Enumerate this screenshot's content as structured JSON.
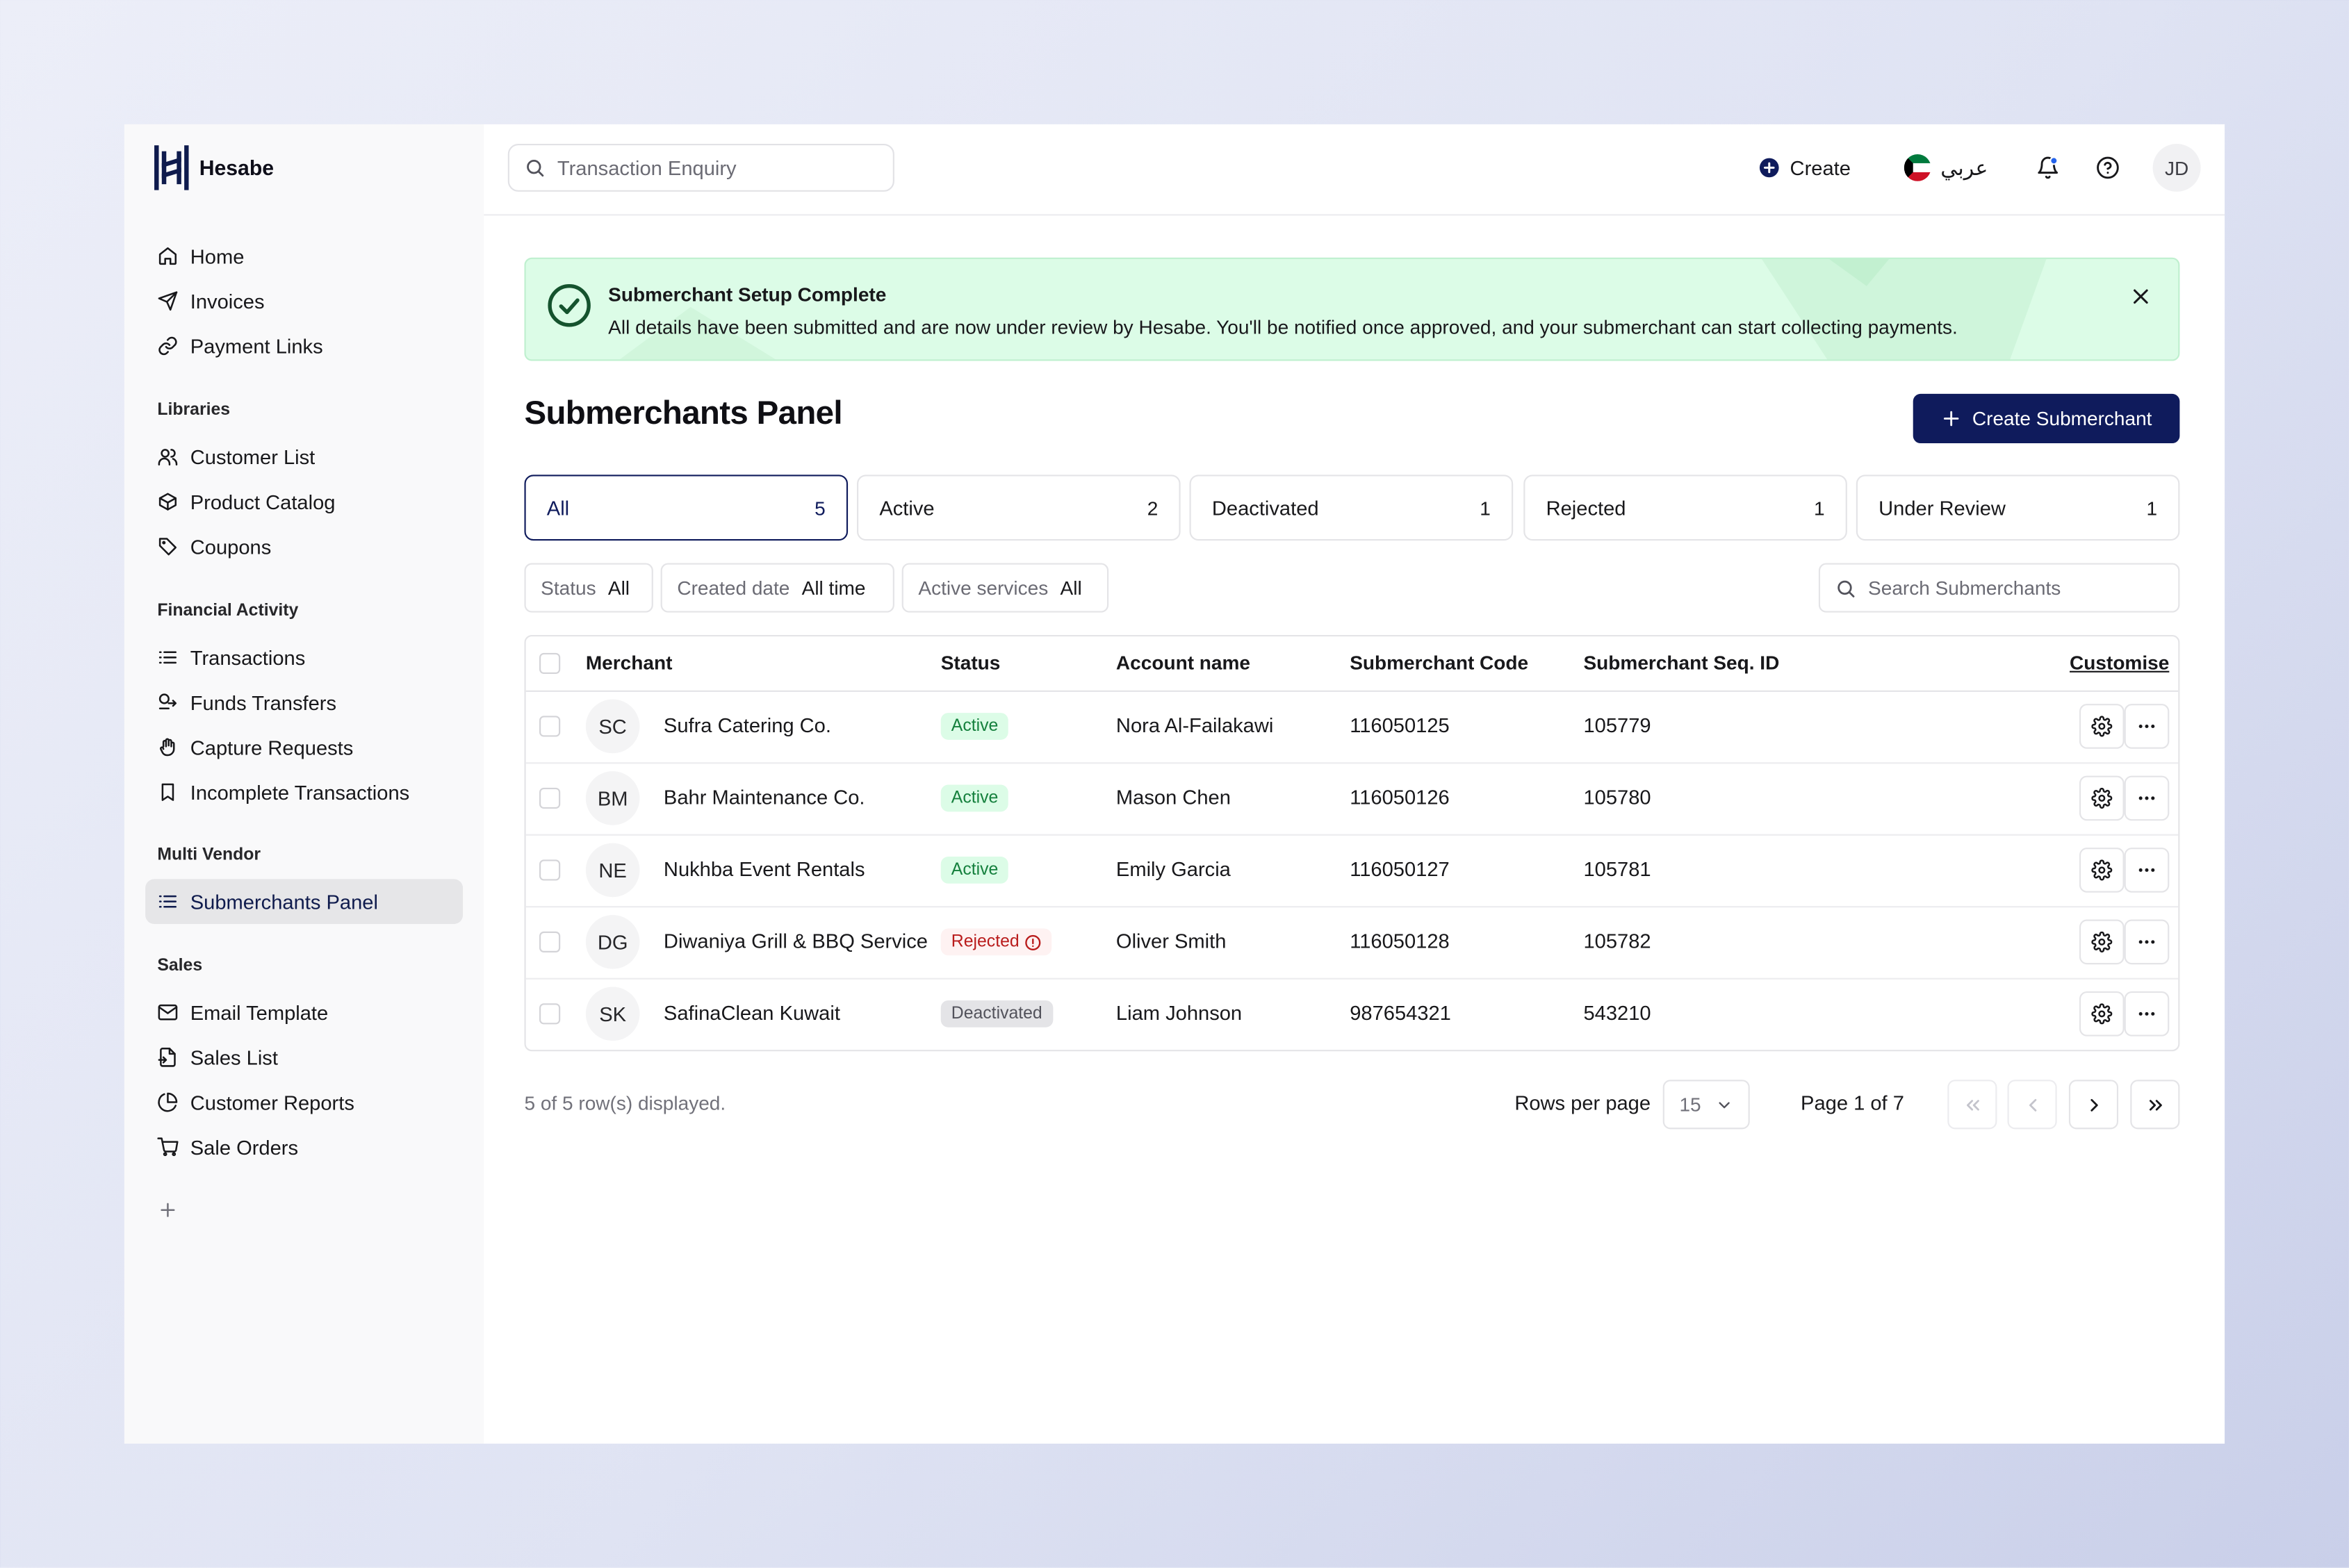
{
  "app": {
    "name": "Hesabe"
  },
  "sidebar": {
    "top_items": [
      {
        "label": "Home",
        "icon": "home-icon"
      },
      {
        "label": "Invoices",
        "icon": "send-icon"
      },
      {
        "label": "Payment Links",
        "icon": "link-icon"
      }
    ],
    "sections": [
      {
        "title": "Libraries",
        "items": [
          {
            "label": "Customer List",
            "icon": "users-icon"
          },
          {
            "label": "Product Catalog",
            "icon": "package-icon"
          },
          {
            "label": "Coupons",
            "icon": "tag-icon"
          }
        ]
      },
      {
        "title": "Financial Activity",
        "items": [
          {
            "label": "Transactions",
            "icon": "list-icon"
          },
          {
            "label": "Funds Transfers",
            "icon": "transfer-icon"
          },
          {
            "label": "Capture Requests",
            "icon": "hand-icon"
          },
          {
            "label": "Incomplete Transactions",
            "icon": "bookmark-icon"
          }
        ]
      },
      {
        "title": "Multi Vendor",
        "items": [
          {
            "label": "Submerchants Panel",
            "icon": "list-icon",
            "active": true
          }
        ]
      },
      {
        "title": "Sales",
        "items": [
          {
            "label": "Email Template",
            "icon": "mail-icon"
          },
          {
            "label": "Sales List",
            "icon": "file-icon"
          },
          {
            "label": "Customer Reports",
            "icon": "pie-chart-icon"
          },
          {
            "label": "Sale Orders",
            "icon": "cart-icon"
          }
        ]
      }
    ],
    "add_icon": "plus-icon"
  },
  "topbar": {
    "search_placeholder": "Transaction Enquiry",
    "create_label": "Create",
    "language_label": "عربي",
    "language_flag": "kuwait-flag-icon",
    "user_initials": "JD"
  },
  "banner": {
    "title": "Submerchant Setup Complete",
    "message": "All details have been submitted and are now under review by Hesabe. You'll be notified once approved, and your submerchant can start collecting payments."
  },
  "page": {
    "title": "Submerchants Panel",
    "create_button": "Create Submerchant"
  },
  "tabs": [
    {
      "label": "All",
      "count": "5",
      "active": true
    },
    {
      "label": "Active",
      "count": "2"
    },
    {
      "label": "Deactivated",
      "count": "1"
    },
    {
      "label": "Rejected",
      "count": "1"
    },
    {
      "label": "Under Review",
      "count": "1"
    }
  ],
  "filters": [
    {
      "label": "Status",
      "value": "All"
    },
    {
      "label": "Created date",
      "value": "All time"
    },
    {
      "label": "Active services",
      "value": "All"
    }
  ],
  "search_submerchants_placeholder": "Search Submerchants",
  "table": {
    "columns": [
      "Merchant",
      "Status",
      "Account name",
      "Submerchant Code",
      "Submerchant Seq. ID"
    ],
    "customise_label": "Customise",
    "rows": [
      {
        "initials": "SC",
        "merchant": "Sufra Catering Co.",
        "status": "Active",
        "status_type": "active",
        "account": "Nora Al-Failakawi",
        "code": "116050125",
        "seq": "105779"
      },
      {
        "initials": "BM",
        "merchant": "Bahr Maintenance Co.",
        "status": "Active",
        "status_type": "active",
        "account": "Mason Chen",
        "code": "116050126",
        "seq": "105780"
      },
      {
        "initials": "NE",
        "merchant": "Nukhba Event Rentals",
        "status": "Active",
        "status_type": "active",
        "account": "Emily Garcia",
        "code": "116050127",
        "seq": "105781"
      },
      {
        "initials": "DG",
        "merchant": "Diwaniya Grill & BBQ Service",
        "status": "Rejected",
        "status_type": "rejected",
        "account": "Oliver Smith",
        "code": "116050128",
        "seq": "105782"
      },
      {
        "initials": "SK",
        "merchant": "SafinaClean Kuwait",
        "status": "Deactivated",
        "status_type": "deactivated",
        "account": "Liam Johnson",
        "code": "987654321",
        "seq": "543210"
      }
    ]
  },
  "footer": {
    "rows_displayed": "5 of 5 row(s) displayed.",
    "rows_per_page_label": "Rows per page",
    "rows_per_page_value": "15",
    "page_label": "Page 1 of 7"
  },
  "colors": {
    "primary": "#0f1b5c",
    "banner_bg": "#dcfce7",
    "active_badge": "#15803d",
    "rejected_badge": "#b91c1c",
    "deactivated_badge": "#52525b"
  }
}
